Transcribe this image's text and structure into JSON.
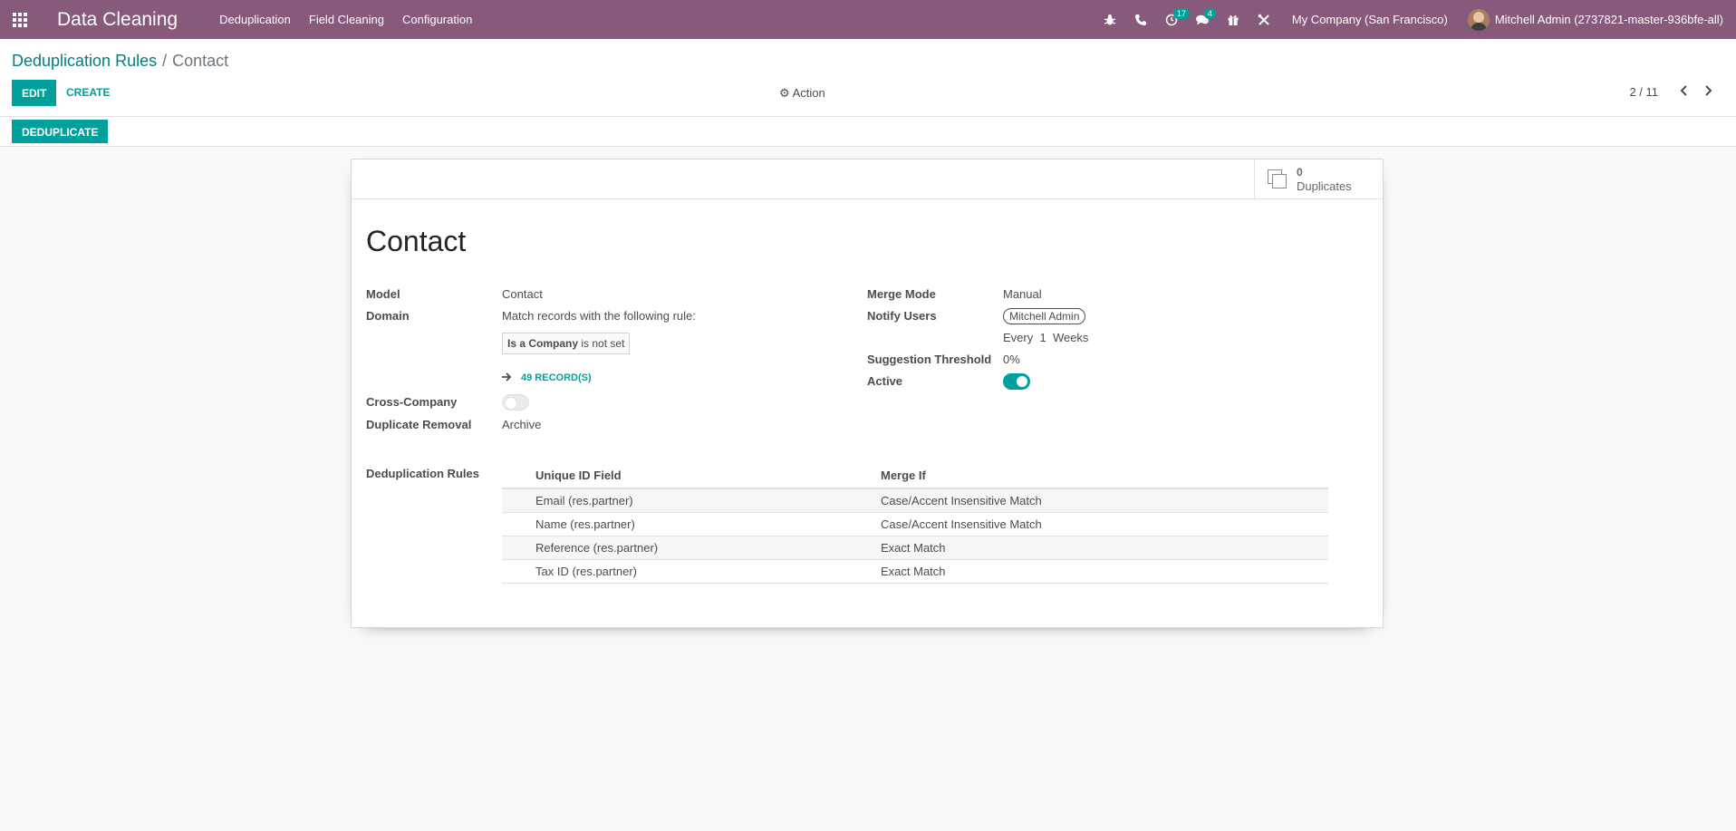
{
  "navbar": {
    "app_title": "Data Cleaning",
    "menu": [
      "Deduplication",
      "Field Cleaning",
      "Configuration"
    ],
    "activity_count": "17",
    "messages_count": "4",
    "company": "My Company (San Francisco)",
    "user": "Mitchell Admin (2737821-master-936bfe-all)",
    "icons": [
      "apps-grid-icon",
      "bug-icon",
      "phone-icon",
      "clock-icon",
      "chat-icon",
      "gift-icon",
      "tools-icon"
    ]
  },
  "breadcrumb": {
    "parent": "Deduplication Rules",
    "separator": "/",
    "current": "Contact"
  },
  "toolbar": {
    "edit_label": "EDIT",
    "create_label": "CREATE",
    "action_label": "Action",
    "pager_value": "2 / 11"
  },
  "statusbar": {
    "deduplicate_label": "DEDUPLICATE"
  },
  "stat": {
    "count": "0",
    "label": "Duplicates"
  },
  "form": {
    "title": "Contact",
    "model_label": "Model",
    "model_value": "Contact",
    "domain_label": "Domain",
    "domain_value": "Match records with the following rule:",
    "domain_field": "Is a Company",
    "domain_operator": "is not set",
    "records_link": "49 RECORD(S)",
    "cross_company_label": "Cross-Company",
    "cross_company_value": false,
    "duplicate_removal_label": "Duplicate Removal",
    "duplicate_removal_value": "Archive",
    "merge_mode_label": "Merge Mode",
    "merge_mode_value": "Manual",
    "notify_users_label": "Notify Users",
    "notify_user_tag": "Mitchell Admin",
    "notify_every": "Every",
    "notify_interval": "1",
    "notify_unit": "Weeks",
    "threshold_label": "Suggestion Threshold",
    "threshold_value": "0%",
    "active_label": "Active",
    "active_value": true,
    "rules_label": "Deduplication Rules"
  },
  "rules_table": {
    "headers": [
      "Unique ID Field",
      "Merge If"
    ],
    "rows": [
      [
        "Email (res.partner)",
        "Case/Accent Insensitive Match"
      ],
      [
        "Name (res.partner)",
        "Case/Accent Insensitive Match"
      ],
      [
        "Reference (res.partner)",
        "Exact Match"
      ],
      [
        "Tax ID (res.partner)",
        "Exact Match"
      ]
    ]
  },
  "colors": {
    "navbar": "#875a7b",
    "primary": "#00a09d",
    "link": "#017e84"
  }
}
